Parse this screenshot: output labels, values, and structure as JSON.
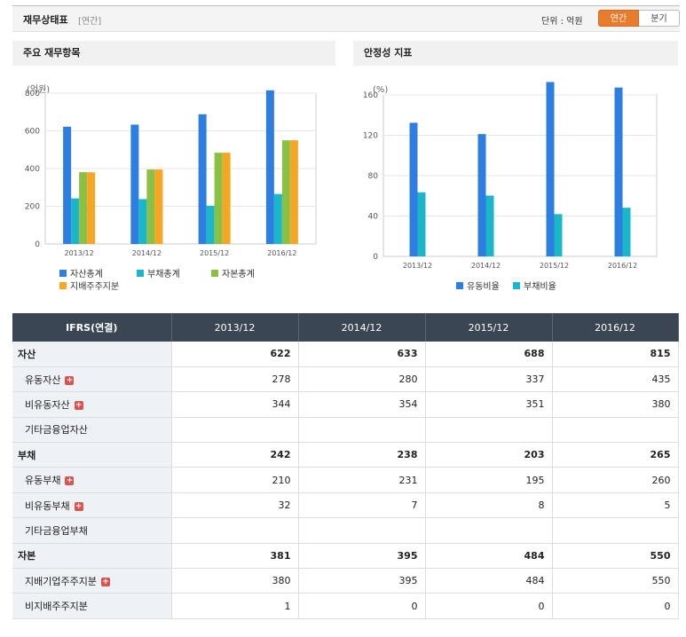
{
  "header": {
    "title": "재무상태표",
    "subtitle": "[연간]",
    "unit_label": "단위 : 억원",
    "toggle_annual": "연간",
    "toggle_quarter": "분기"
  },
  "panels": {
    "left_title": "주요 재무항목",
    "right_title": "안정성 지표"
  },
  "colors": {
    "blue": "#2e7de0",
    "teal": "#1bb7c9",
    "green": "#8cc045",
    "orange": "#f5a623"
  },
  "chart_data": [
    {
      "type": "bar",
      "title": "주요 재무항목",
      "ylabel": "(억원)",
      "categories": [
        "2013/12",
        "2014/12",
        "2015/12",
        "2016/12"
      ],
      "ylim": [
        0,
        800
      ],
      "yticks": [
        0,
        200,
        400,
        600,
        800
      ],
      "grid": true,
      "legend": "bottom",
      "series": [
        {
          "name": "자산총계",
          "color": "#2e7de0",
          "values": [
            622,
            633,
            688,
            815
          ]
        },
        {
          "name": "부채총계",
          "color": "#1bb7c9",
          "values": [
            242,
            238,
            203,
            265
          ]
        },
        {
          "name": "자본총계",
          "color": "#8cc045",
          "values": [
            381,
            395,
            484,
            550
          ]
        },
        {
          "name": "지배주주지분",
          "color": "#f5a623",
          "values": [
            380,
            395,
            484,
            550
          ]
        }
      ]
    },
    {
      "type": "bar",
      "title": "안정성 지표",
      "ylabel": "(%)",
      "categories": [
        "2013/12",
        "2014/12",
        "2015/12",
        "2016/12"
      ],
      "ylim": [
        0,
        160
      ],
      "yticks": [
        0,
        40,
        80,
        120,
        160
      ],
      "grid": true,
      "legend": "bottom",
      "series": [
        {
          "name": "유동비율",
          "color": "#2e7de0",
          "values": [
            132.4,
            121.2,
            172.8,
            167.3
          ]
        },
        {
          "name": "부채비율",
          "color": "#1bb7c9",
          "values": [
            63.5,
            60.3,
            41.9,
            48.2
          ]
        }
      ]
    }
  ],
  "table": {
    "headers": [
      "IFRS(연결)",
      "2013/12",
      "2014/12",
      "2015/12",
      "2016/12"
    ],
    "rows": [
      {
        "label": "자산",
        "major": true,
        "plus": false,
        "values": [
          "622",
          "633",
          "688",
          "815"
        ]
      },
      {
        "label": "유동자산",
        "major": false,
        "plus": true,
        "values": [
          "278",
          "280",
          "337",
          "435"
        ]
      },
      {
        "label": "비유동자산",
        "major": false,
        "plus": true,
        "values": [
          "344",
          "354",
          "351",
          "380"
        ]
      },
      {
        "label": "기타금융업자산",
        "major": false,
        "plus": false,
        "values": [
          "",
          "",
          "",
          ""
        ]
      },
      {
        "label": "부채",
        "major": true,
        "plus": false,
        "values": [
          "242",
          "238",
          "203",
          "265"
        ]
      },
      {
        "label": "유동부채",
        "major": false,
        "plus": true,
        "values": [
          "210",
          "231",
          "195",
          "260"
        ]
      },
      {
        "label": "비유동부채",
        "major": false,
        "plus": true,
        "values": [
          "32",
          "7",
          "8",
          "5"
        ]
      },
      {
        "label": "기타금융업부채",
        "major": false,
        "plus": false,
        "values": [
          "",
          "",
          "",
          ""
        ]
      },
      {
        "label": "자본",
        "major": true,
        "plus": false,
        "values": [
          "381",
          "395",
          "484",
          "550"
        ]
      },
      {
        "label": "지배기업주주지분",
        "major": false,
        "plus": true,
        "values": [
          "380",
          "395",
          "484",
          "550"
        ]
      },
      {
        "label": "비지배주주지분",
        "major": false,
        "plus": false,
        "values": [
          "1",
          "0",
          "0",
          "0"
        ]
      }
    ]
  }
}
